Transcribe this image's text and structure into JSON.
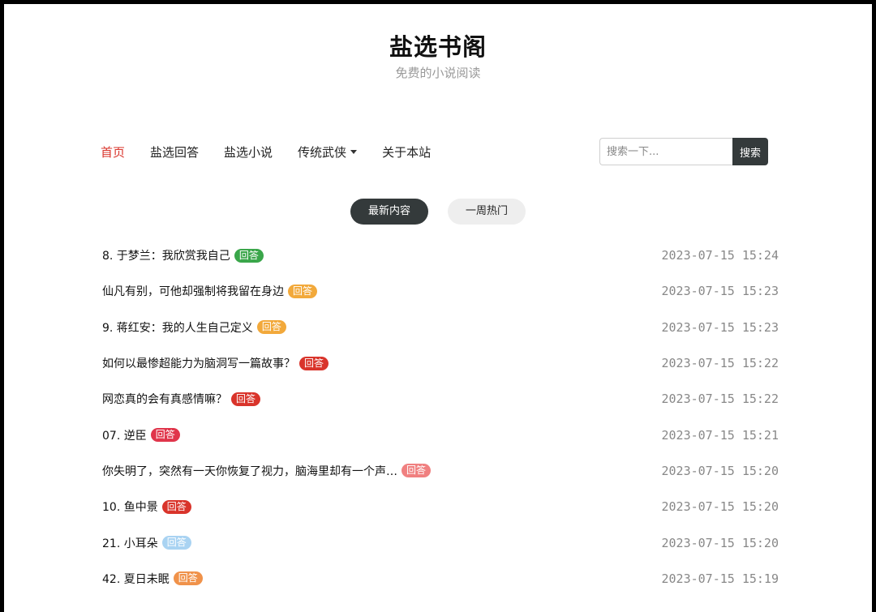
{
  "site": {
    "title": "盐选书阁",
    "subtitle": "免费的小说阅读"
  },
  "nav": {
    "items": [
      {
        "label": "首页",
        "active": true
      },
      {
        "label": "盐选回答",
        "active": false
      },
      {
        "label": "盐选小说",
        "active": false
      },
      {
        "label": "传统武侠",
        "active": false,
        "dropdown": true
      },
      {
        "label": "关于本站",
        "active": false
      }
    ],
    "active_color": "#d9342b"
  },
  "search": {
    "placeholder": "搜索一下...",
    "button_label": "搜索"
  },
  "tabs": [
    {
      "label": "最新内容",
      "active": true
    },
    {
      "label": "一周热门",
      "active": false
    }
  ],
  "list": {
    "items": [
      {
        "title": "8. 于梦兰：我欣赏我自己",
        "badge": "回答",
        "badge_color": "#3aa64a",
        "time": "2023-07-15 15:24"
      },
      {
        "title": "仙凡有别，可他却强制将我留在身边",
        "badge": "回答",
        "badge_color": "#f2a93b",
        "time": "2023-07-15 15:23"
      },
      {
        "title": "9. 蒋红安：我的人生自己定义",
        "badge": "回答",
        "badge_color": "#f2a93b",
        "time": "2023-07-15 15:23"
      },
      {
        "title": "如何以最惨超能力为脑洞写一篇故事？",
        "badge": "回答",
        "badge_color": "#d9342b",
        "time": "2023-07-15 15:22"
      },
      {
        "title": "网恋真的会有真感情嘛？",
        "badge": "回答",
        "badge_color": "#d9342b",
        "time": "2023-07-15 15:22"
      },
      {
        "title": "07. 逆臣",
        "badge": "回答",
        "badge_color": "#e0354b",
        "time": "2023-07-15 15:21"
      },
      {
        "title": "你失明了，突然有一天你恢复了视力，脑海里却有一个声…",
        "badge": "回答",
        "badge_color": "#f08080",
        "time": "2023-07-15 15:20"
      },
      {
        "title": "10. 鱼中景",
        "badge": "回答",
        "badge_color": "#d9342b",
        "time": "2023-07-15 15:20"
      },
      {
        "title": "21. 小耳朵",
        "badge": "回答",
        "badge_color": "#a9d3f2",
        "time": "2023-07-15 15:20"
      },
      {
        "title": "42. 夏日未眠",
        "badge": "回答",
        "badge_color": "#f0924a",
        "time": "2023-07-15 15:19"
      }
    ]
  }
}
